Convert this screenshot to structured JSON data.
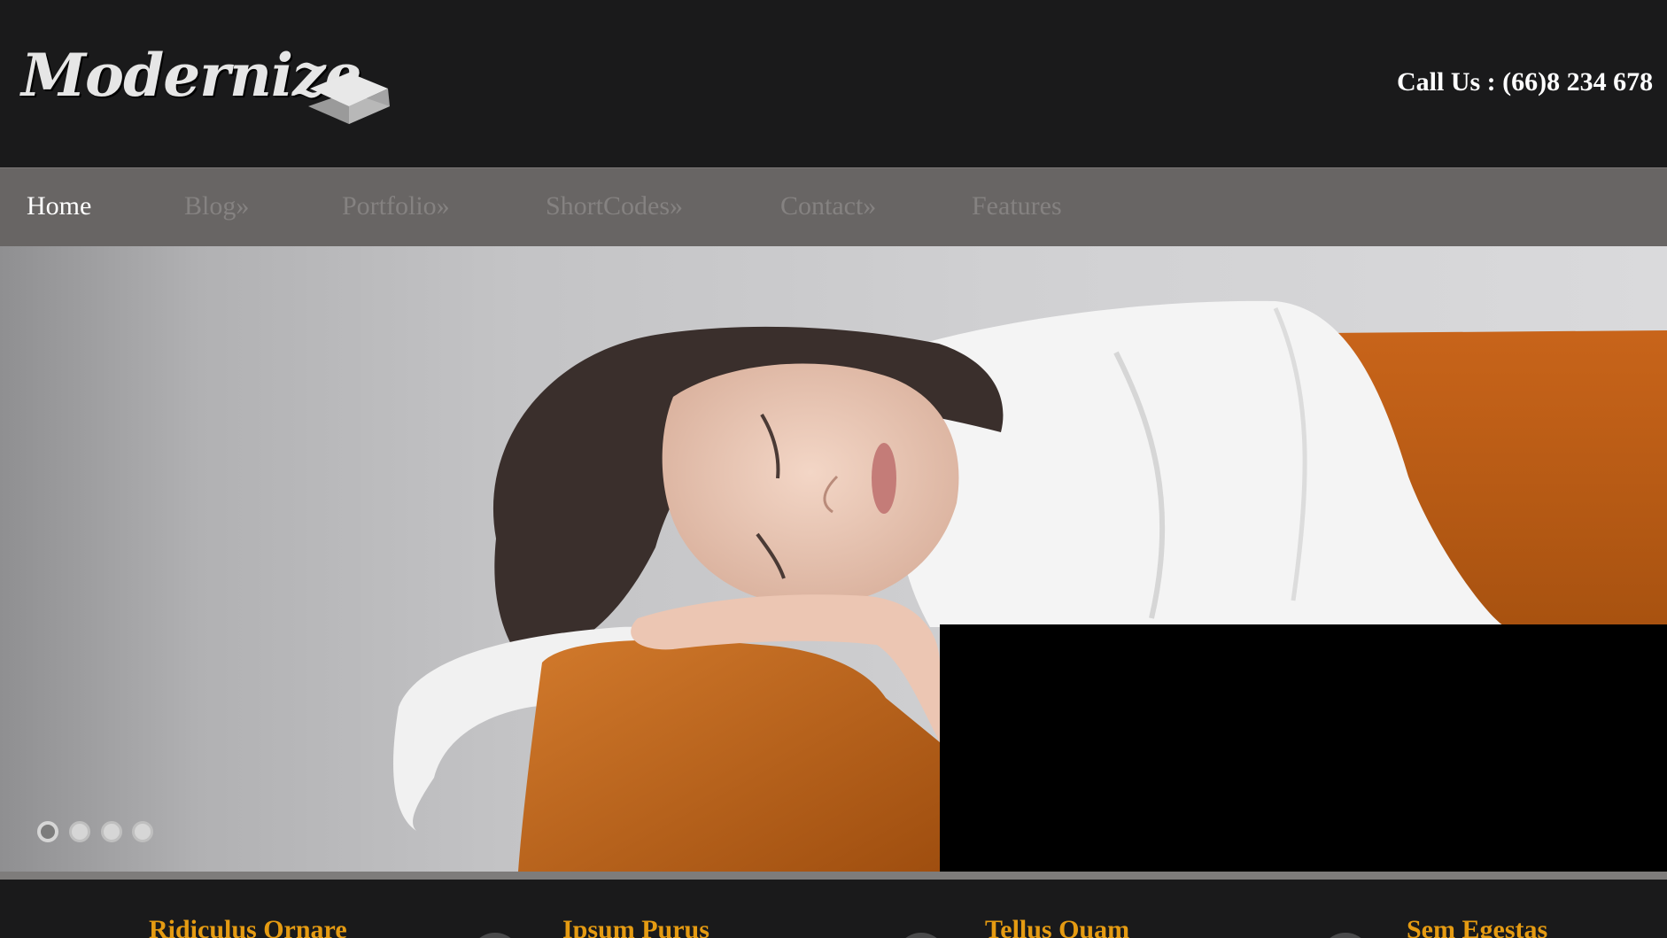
{
  "header": {
    "logo_text": "Modernize",
    "logo_icon": "layers-diamond-icon",
    "call_us": "Call Us : (66)8 234 678"
  },
  "nav": {
    "items": [
      {
        "label": "Home",
        "active": true
      },
      {
        "label": "Blog»",
        "active": false
      },
      {
        "label": "Portfolio»",
        "active": false
      },
      {
        "label": "ShortCodes»",
        "active": false
      },
      {
        "label": "Contact»",
        "active": false
      },
      {
        "label": "Features",
        "active": false
      }
    ]
  },
  "slider": {
    "slide_count": 4,
    "active_slide": 1
  },
  "features": {
    "items": [
      {
        "title": "Ridiculus Ornare"
      },
      {
        "title": "Ipsum Purus"
      },
      {
        "title": "Tellus Quam"
      },
      {
        "title": "Sem Egestas"
      }
    ]
  },
  "colors": {
    "header_bg": "#1a1a1b",
    "nav_bg": "#686564",
    "nav_active": "#ffffff",
    "nav_inactive": "#858281",
    "feature_title": "#e59b12"
  }
}
